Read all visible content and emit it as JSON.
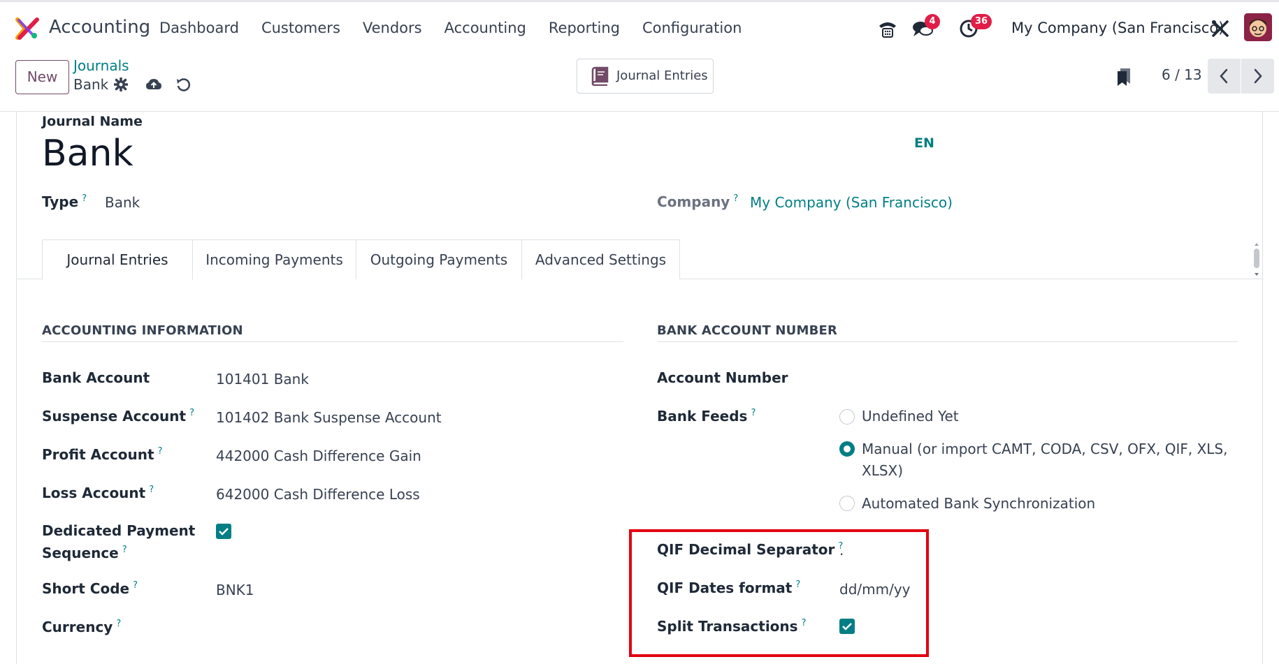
{
  "navbar": {
    "app_name": "Accounting",
    "menu": [
      "Dashboard",
      "Customers",
      "Vendors",
      "Accounting",
      "Reporting",
      "Configuration"
    ],
    "messages_badge": "4",
    "activities_badge": "36",
    "company": "My Company (San Francisco)"
  },
  "control": {
    "new_label": "New",
    "breadcrumb_parent": "Journals",
    "breadcrumb_current": "Bank",
    "smart_button": "Journal Entries",
    "pager": "6 / 13"
  },
  "header": {
    "journal_name_label": "Journal Name",
    "journal_name": "Bank",
    "lang": "EN",
    "type_label": "Type",
    "type_value": "Bank",
    "company_label": "Company",
    "company_value": "My Company (San Francisco)"
  },
  "tabs": [
    "Journal Entries",
    "Incoming Payments",
    "Outgoing Payments",
    "Advanced Settings"
  ],
  "accounting": {
    "heading": "ACCOUNTING INFORMATION",
    "bank_account_label": "Bank Account",
    "bank_account": "101401 Bank",
    "suspense_label": "Suspense Account",
    "suspense": "101402 Bank Suspense Account",
    "profit_label": "Profit Account",
    "profit": "442000 Cash Difference Gain",
    "loss_label": "Loss Account",
    "loss": "642000 Cash Difference Loss",
    "dedicated_label_1": "Dedicated Payment",
    "dedicated_label_2": "Sequence",
    "dedicated_checked": true,
    "short_code_label": "Short Code",
    "short_code": "BNK1",
    "currency_label": "Currency"
  },
  "bank": {
    "heading": "BANK ACCOUNT NUMBER",
    "account_number_label": "Account Number",
    "feeds_label": "Bank Feeds",
    "feeds_options": [
      "Undefined Yet",
      "Manual (or import CAMT, CODA, CSV, OFX, QIF, XLS,",
      "XLSX)",
      "Automated Bank Synchronization"
    ],
    "feeds_selected": "Manual",
    "qif_decimal_label": "QIF Decimal Separator",
    "qif_decimal": ".",
    "qif_dates_label": "QIF Dates format",
    "qif_dates": "dd/mm/yy",
    "split_label": "Split Transactions",
    "split_checked": true
  },
  "colors": {
    "brand": "#714b67",
    "accent": "#017e84",
    "highlight": "#e3000f",
    "badge": "#e11d48"
  }
}
